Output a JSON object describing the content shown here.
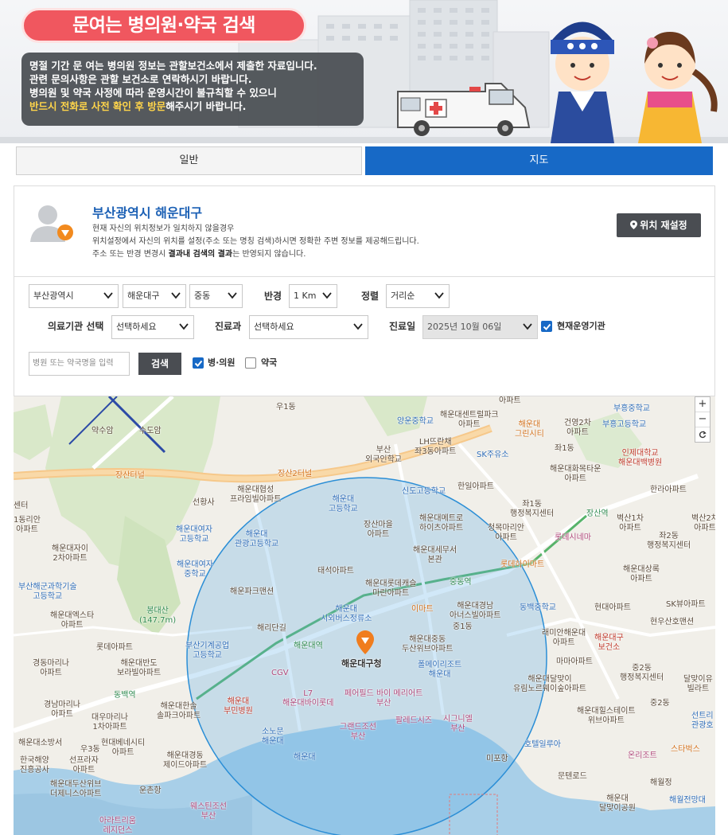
{
  "banner": {
    "title": "문여는 병의원·약국 검색",
    "notice_lines": [
      "명절 기간 문 여는 병의원 정보는 관할보건소에서 제출한 자료입니다.",
      "관련 문의사항은 관할 보건소로 연락하시기 바랍니다.",
      "병의원 및 약국 사정에 따라 운영시간이 불규칙할 수 있으니"
    ],
    "notice_highlight": "반드시 전화로 사전 확인 후 방문",
    "notice_tail": "해주시기 바랍니다."
  },
  "tabs": [
    {
      "label": "일반",
      "active": false
    },
    {
      "label": "지도",
      "active": true
    }
  ],
  "location": {
    "title": "부산광역시 해운대구",
    "line1": "현재 자신의 위치정보가 일치하지 않을경우",
    "line2": "위치설정에서 자신의 위치를 설정(주소 또는 명칭 검색)하시면 정확한 주변 정보를 제공해드립니다.",
    "line3_pre": "주소 또는 반경 변경시 ",
    "line3_bold": "결과내 검색의 결과",
    "line3_post": "는 반영되지 않습니다.",
    "reset_label": "위치 재설정"
  },
  "filters": {
    "sido": "부산광역시",
    "sigungu": "해운대구",
    "dong": "중동",
    "radius_label": "반경",
    "radius": "1 Km",
    "sort_label": "정렬",
    "sort": "거리순",
    "inst_label": "의료기관 선택",
    "inst": "선택하세요",
    "dept_label": "진료과",
    "dept": "선택하세요",
    "date_label": "진료일",
    "date": "2025년 10월 06일",
    "open_now_label": "현재운영기관",
    "open_now": true,
    "search_placeholder": "병원 또는 약국명을 입력",
    "search_button": "검색",
    "hospital_label": "병·의원",
    "hospital": true,
    "pharmacy_label": "약국",
    "pharmacy": false
  },
  "map": {
    "zoom_in": "+",
    "zoom_out": "−",
    "labels": [
      {
        "t": "우1동",
        "c": "grey"
      },
      {
        "t": "약수암",
        "c": "grey"
      },
      {
        "t": "수도암",
        "c": "grey"
      },
      {
        "t": "장산터널",
        "c": "orange"
      },
      {
        "t": "장산2터널",
        "c": "orange"
      },
      {
        "t": "해운대협성\n프라임빌아파트",
        "c": "grey"
      },
      {
        "t": "선황사",
        "c": "grey"
      },
      {
        "t": "해운대여자\n고등학교",
        "c": "blue"
      },
      {
        "t": "해운대\n관광고등학교",
        "c": "blue"
      },
      {
        "t": "해운대자이\n2차아파트",
        "c": "grey"
      },
      {
        "t": "해운대여자\n중학교",
        "c": "blue"
      },
      {
        "t": "부산해군과학기술\n고등학교",
        "c": "blue"
      },
      {
        "t": "해운대엑스타\n아파트",
        "c": "grey"
      },
      {
        "t": "봉대산\n(147.7m)",
        "c": "green"
      },
      {
        "t": "해운파크맨션",
        "c": "grey"
      },
      {
        "t": "롯데아파트",
        "c": "grey"
      },
      {
        "t": "해리단길",
        "c": "grey"
      },
      {
        "t": "경동마리나\n아파트",
        "c": "grey"
      },
      {
        "t": "해운대반도\n보라빌아파트",
        "c": "grey"
      },
      {
        "t": "부산기계공업\n고등학교",
        "c": "blue"
      },
      {
        "t": "CGV",
        "c": "pink"
      },
      {
        "t": "동백역",
        "c": "green"
      },
      {
        "t": "해운대\n부민병원",
        "c": "red"
      },
      {
        "t": "경남마리나\n아파트",
        "c": "grey"
      },
      {
        "t": "대우마리나\n1차아파트",
        "c": "grey"
      },
      {
        "t": "해운대한솔\n솔파크아파트",
        "c": "grey"
      },
      {
        "t": "해운대소방서",
        "c": "grey"
      },
      {
        "t": "우3동",
        "c": "grey"
      },
      {
        "t": "현대베네시티\n아파트",
        "c": "grey"
      },
      {
        "t": "한국해양\n진흥공사",
        "c": "grey"
      },
      {
        "t": "선프라자\n아파트",
        "c": "grey"
      },
      {
        "t": "해운대경동\n제이드아파트",
        "c": "grey"
      },
      {
        "t": "해운대두산위브\n더제니스아파트",
        "c": "grey"
      },
      {
        "t": "운촌항",
        "c": "grey"
      },
      {
        "t": "아라트리움\n레지던스",
        "c": "pink"
      },
      {
        "t": "웨스틴조선\n부산",
        "c": "pink"
      },
      {
        "t": "해운대",
        "c": "blue"
      },
      {
        "t": "소노문\n해운대",
        "c": "blue"
      },
      {
        "t": "L7\n해운대바이롯데",
        "c": "pink"
      },
      {
        "t": "그랜드조선\n부산",
        "c": "pink"
      },
      {
        "t": "페어필드 바이 메리어트\n부산",
        "c": "pink"
      },
      {
        "t": "팔레드시즈",
        "c": "pink"
      },
      {
        "t": "시그니엘\n부산",
        "c": "pink"
      },
      {
        "t": "해운대구청",
        "c": "dark"
      },
      {
        "t": "해운대역",
        "c": "green"
      },
      {
        "t": "해운대\n시외버스정류소",
        "c": "blue"
      },
      {
        "t": "폴메이리조트\n해운대",
        "c": "blue"
      },
      {
        "t": "해운대중동\n두산위브아파트",
        "c": "grey"
      },
      {
        "t": "이마트",
        "c": "orange"
      },
      {
        "t": "해운대롯데캐슬\n마린아파트",
        "c": "grey"
      },
      {
        "t": "중동역",
        "c": "green"
      },
      {
        "t": "태석아파트",
        "c": "grey"
      },
      {
        "t": "해운대세무서\n본관",
        "c": "grey"
      },
      {
        "t": "장산마을\n아파트",
        "c": "grey"
      },
      {
        "t": "해운대\n고등학교",
        "c": "blue"
      },
      {
        "t": "신도고등학교",
        "c": "blue"
      },
      {
        "t": "해운대메트로\n하이츠아파트",
        "c": "grey"
      },
      {
        "t": "부산\n외국인학교",
        "c": "grey"
      },
      {
        "t": "LH뜨란채\n좌3동아파트",
        "c": "grey"
      },
      {
        "t": "SK주유소",
        "c": "blue"
      },
      {
        "t": "한일아파트",
        "c": "grey"
      },
      {
        "t": "양운중학교",
        "c": "blue"
      },
      {
        "t": "해운대센트럴파크\n아파트",
        "c": "grey"
      },
      {
        "t": "해운대\n그린시티",
        "c": "orange"
      },
      {
        "t": "건영2차\n아파트",
        "c": "grey"
      },
      {
        "t": "좌1동",
        "c": "grey"
      },
      {
        "t": "부흥중학교",
        "c": "blue"
      },
      {
        "t": "부흥고등학교",
        "c": "blue"
      },
      {
        "t": "인제대학교\n해운대백병원",
        "c": "red"
      },
      {
        "t": "해운대화목타운\n아파트",
        "c": "grey"
      },
      {
        "t": "한라아파트",
        "c": "grey"
      },
      {
        "t": "좌1동\n행정복지센터",
        "c": "grey"
      },
      {
        "t": "장산역",
        "c": "green"
      },
      {
        "t": "벽산1차\n아파트",
        "c": "grey"
      },
      {
        "t": "벽산2차\n아파트",
        "c": "grey"
      },
      {
        "t": "좌2동\n행정복지센터",
        "c": "grey"
      },
      {
        "t": "청목마리안\n아파트",
        "c": "grey"
      },
      {
        "t": "롯데시네마",
        "c": "pink"
      },
      {
        "t": "롯데하이마트",
        "c": "orange"
      },
      {
        "t": "해운대상록\n아파트",
        "c": "grey"
      },
      {
        "t": "동백중학교",
        "c": "blue"
      },
      {
        "t": "해운대경남\n아너스빌아파트",
        "c": "grey"
      },
      {
        "t": "중1동",
        "c": "grey"
      },
      {
        "t": "현대아파트",
        "c": "grey"
      },
      {
        "t": "SK뷰아파트",
        "c": "grey"
      },
      {
        "t": "현우산호맨션",
        "c": "grey"
      },
      {
        "t": "래미안해운대\n아파트",
        "c": "grey"
      },
      {
        "t": "해운대구\n보건소",
        "c": "red"
      },
      {
        "t": "마마아파트",
        "c": "grey"
      },
      {
        "t": "중2동\n행정복지센터",
        "c": "grey"
      },
      {
        "t": "달맞이유\n빌라트",
        "c": "grey"
      },
      {
        "t": "해운대달맞이\n유림노르웨이숲아파트",
        "c": "grey"
      },
      {
        "t": "중2동",
        "c": "grey"
      },
      {
        "t": "해운대힐스테이트\n위브아파트",
        "c": "grey"
      },
      {
        "t": "선트리\n관광호",
        "c": "blue"
      },
      {
        "t": "호텔일루아",
        "c": "blue"
      },
      {
        "t": "미포항",
        "c": "grey"
      },
      {
        "t": "온리조트",
        "c": "pink"
      },
      {
        "t": "스타벅스",
        "c": "orange"
      },
      {
        "t": "문텐로드",
        "c": "grey"
      },
      {
        "t": "해월정",
        "c": "grey"
      },
      {
        "t": "해운대\n달맞이공원",
        "c": "grey"
      },
      {
        "t": "해월전망대",
        "c": "blue"
      },
      {
        "t": "센터",
        "c": "grey"
      },
      {
        "t": "1동리안\n아파트",
        "c": "grey"
      },
      {
        "t": "아파트",
        "c": "grey"
      }
    ]
  }
}
